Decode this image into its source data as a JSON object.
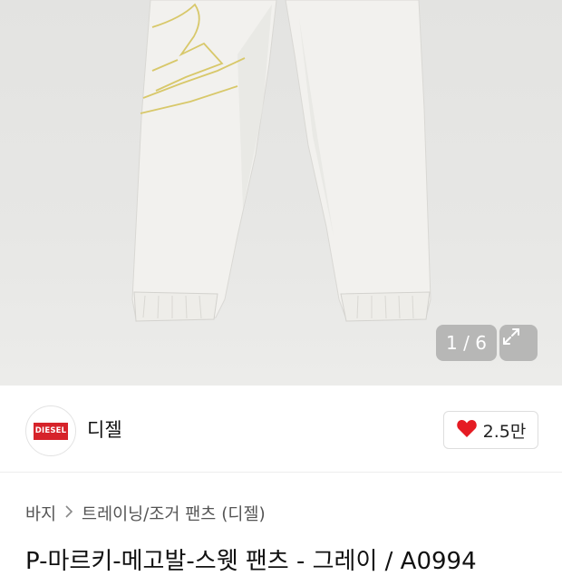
{
  "gallery": {
    "counter": "1 / 6",
    "expand_icon": "expand-icon"
  },
  "brand": {
    "logo_text": "DIESEL",
    "name": "디젤",
    "like_icon": "heart-icon",
    "like_color": "#e51b23",
    "like_count": "2.5만"
  },
  "breadcrumb": {
    "items": [
      "바지",
      "트레이닝/조거 팬츠 (디젤)"
    ],
    "separator_icon": "chevron-right-icon"
  },
  "product": {
    "title": "P-마르키-메고발-스웻 팬츠 - 그레이 / A0994"
  }
}
